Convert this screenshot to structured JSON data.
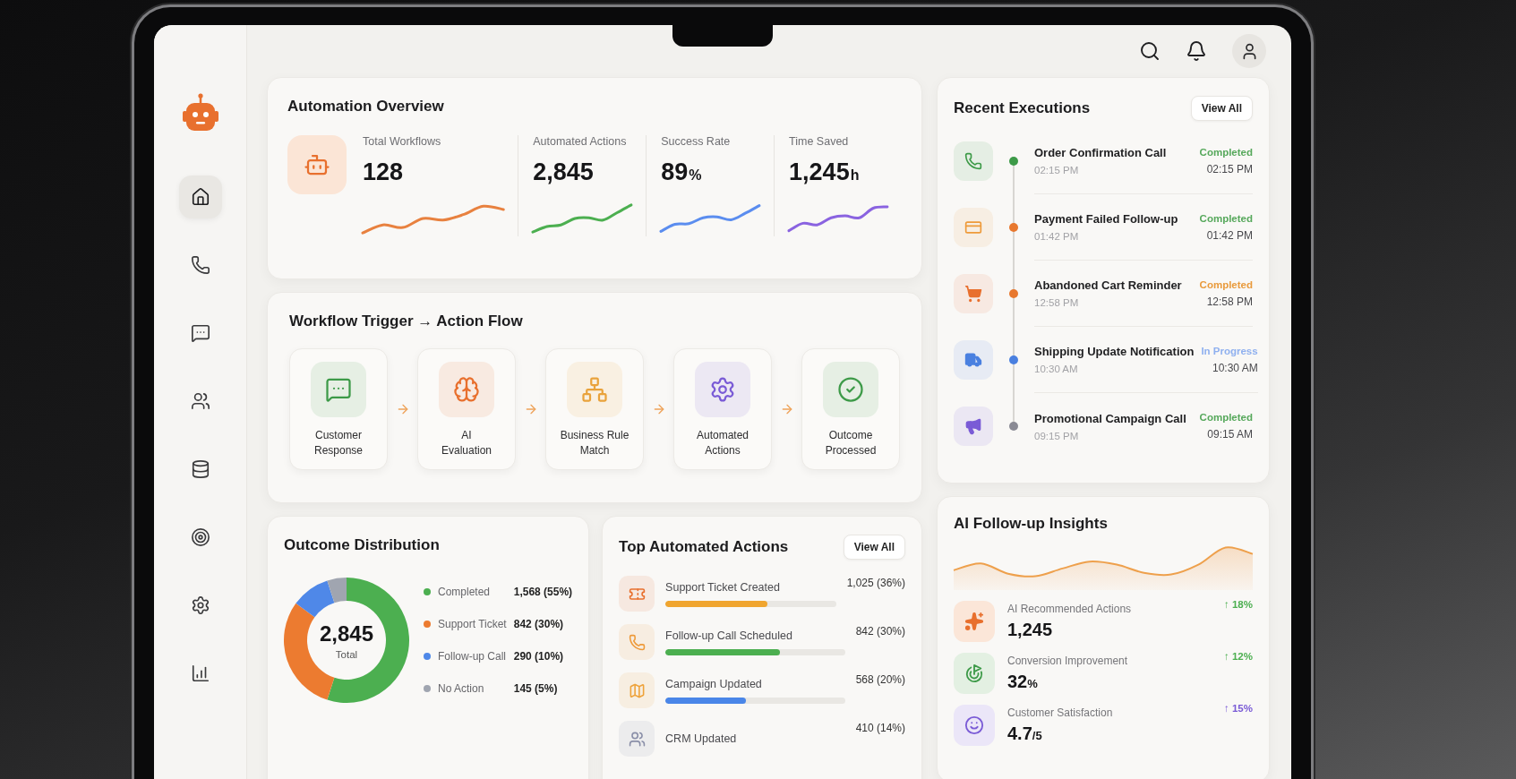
{
  "sidebar": {
    "items": [
      {
        "selected": true
      },
      {
        "selected": false
      },
      {
        "selected": false
      },
      {
        "selected": false
      },
      {
        "selected": false
      },
      {
        "selected": false
      },
      {
        "selected": false
      },
      {
        "selected": false
      }
    ]
  },
  "overview": {
    "title": "Automation Overview",
    "stats": [
      {
        "label": "Total Workflows",
        "value": "128",
        "color": "#e8813f"
      },
      {
        "label": "Automated Actions",
        "value": "2,845",
        "color": "#4caf50"
      },
      {
        "label": "Success Rate",
        "value": "89",
        "unit": "%",
        "color": "#5b8def"
      },
      {
        "label": "Time Saved",
        "value": "1,245",
        "unit": "h",
        "color": "#8a63e0"
      }
    ]
  },
  "workflow": {
    "title": "Workflow Trigger → Action Flow",
    "steps": [
      {
        "label": "Customer\nResponse",
        "color": "#3d9a48"
      },
      {
        "label": "AI\nEvaluation",
        "color": "#e8702e"
      },
      {
        "label": "Business Rule\nMatch",
        "color": "#e9a23b"
      },
      {
        "label": "Automated\nActions",
        "color": "#7a5bd6"
      },
      {
        "label": "Outcome\nProcessed",
        "color": "#3d9a48"
      }
    ]
  },
  "outcome": {
    "title": "Outcome Distribution",
    "total": "2,845",
    "total_label": "Total",
    "legend": [
      {
        "value": "1,568 (55%)",
        "color": "#4caf50"
      },
      {
        "value": "842 (30%)",
        "color": "#ec7b30"
      },
      {
        "value": "290 (10%)",
        "color": "#4f88e8"
      },
      {
        "value": "145 (5%)",
        "color": "#a0a5b0"
      }
    ],
    "chart_data": {
      "type": "donut",
      "categories": [
        "Completed",
        "Support Ticket",
        "Follow-up Call",
        "No Action"
      ],
      "values": [
        55,
        30,
        10,
        5
      ]
    }
  },
  "top_actions": {
    "title": "Top Automated Actions",
    "button": "View All",
    "items": [
      {
        "label": "Support Ticket Created",
        "value": "1,025 (36%)",
        "level": 0.6,
        "color": "#f0a52f"
      },
      {
        "label": "Follow-up Call Scheduled",
        "value": "842 (30%)",
        "level": 0.64,
        "color": "#4caf50"
      },
      {
        "label": "Campaign Updated",
        "value": "568 (20%)",
        "level": 0.45,
        "color": "#4a86e8"
      },
      {
        "label": "CRM Updated",
        "value": "410 (14%)"
      }
    ]
  },
  "recent_executions": {
    "title": "Recent Executions",
    "button": "View All",
    "items": [
      {
        "name": "Order Confirmation Call",
        "time": "02:15 PM",
        "icon": {
          "color": "#3d9a48"
        },
        "color": "#3d9a48",
        "status": {
          "text": "Completed",
          "color": "#56a85b"
        },
        "status_time": "02:15 PM"
      },
      {
        "name": "Payment Failed Follow-up",
        "time": "01:42 PM",
        "icon": {
          "color": "#ee9a3a"
        },
        "color": "#e8782e",
        "status": {
          "text": "Completed",
          "color": "#56a85b"
        },
        "status_time": "01:42 PM"
      },
      {
        "name": "Abandoned Cart Reminder",
        "time": "12:58 PM",
        "icon": {
          "color": "#e8702e"
        },
        "color": "#e8782e",
        "status": {
          "text": "Completed",
          "color": "#e99a3c"
        },
        "status_time": "12:58 PM"
      },
      {
        "name": "Shipping Update Notification",
        "time": "10:30 AM",
        "icon": {
          "color": "#4a80e0"
        },
        "color": "#4a80e0",
        "status": {
          "text": "In Progress",
          "color": "#8fb0ef"
        },
        "status_time": "10:30 AM"
      },
      {
        "name": "Promotional Campaign Call",
        "time": "09:15 PM",
        "icon": {
          "color": "#7a5bd6"
        },
        "color": "#8a8a94",
        "status": {
          "text": "Completed",
          "color": "#56a85b"
        },
        "status_time": "09:15 AM"
      }
    ]
  },
  "insights": {
    "title": "AI Follow-up Insights",
    "items": [
      {
        "label": "AI Recommended Actions",
        "value": "1,245",
        "change": {
          "text": "↑ 18%",
          "color": "#4caf50"
        }
      },
      {
        "label": "Conversion Improvement",
        "value": "32",
        "unit": "%",
        "change": {
          "text": "↑ 12%",
          "color": "#4caf50"
        }
      },
      {
        "label": "Customer Satisfaction",
        "value": "4.7",
        "unit": "/5",
        "change": {
          "text": "↑ 15%",
          "color": "#7a5bd6"
        }
      }
    ]
  }
}
